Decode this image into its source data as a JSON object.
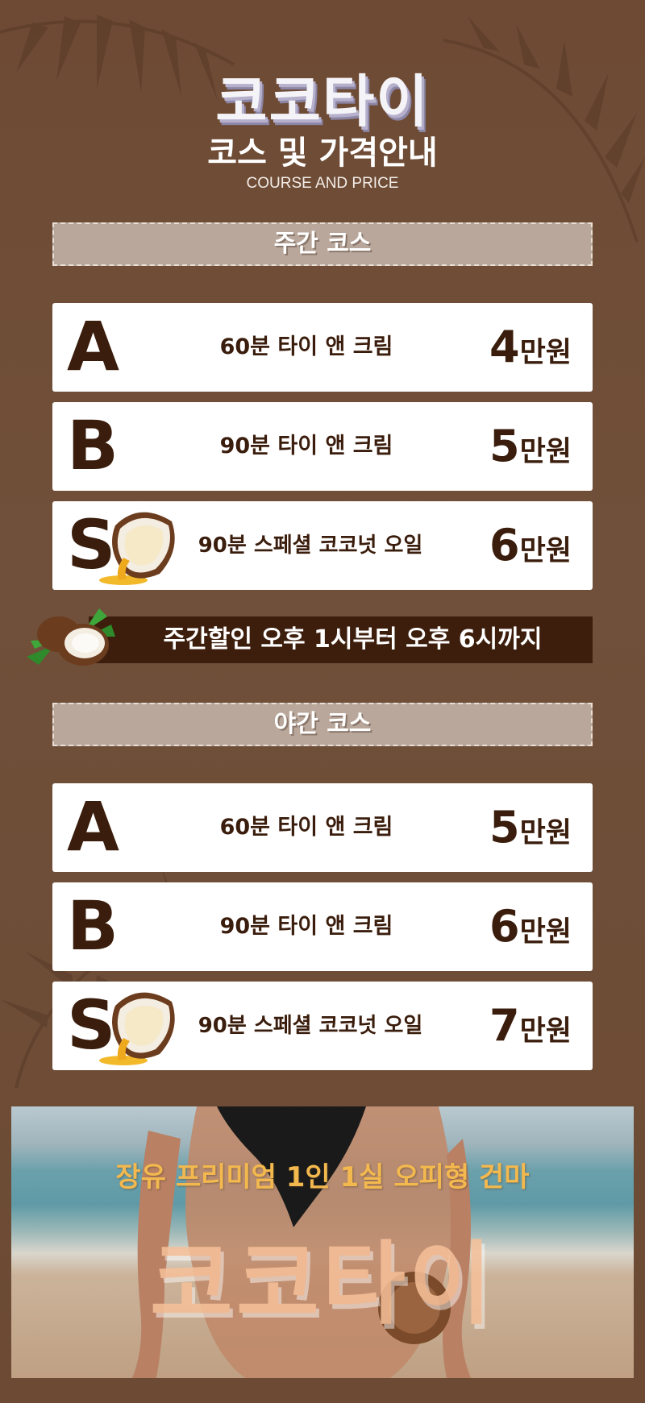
{
  "header": {
    "title": "코코타이",
    "subtitle": "코스 및 가격안내",
    "subtitle_en": "COURSE AND PRICE"
  },
  "day_course": {
    "label": "주간 코스",
    "items": [
      {
        "letter": "A",
        "name": "60분 타이 앤 크림",
        "price_num": "4",
        "price_unit": "만원"
      },
      {
        "letter": "B",
        "name": "90분 타이 앤 크림",
        "price_num": "5",
        "price_unit": "만원"
      },
      {
        "letter": "S",
        "name": "90분 스페셜 코코넛 오일",
        "price_num": "6",
        "price_unit": "만원"
      }
    ]
  },
  "discount": {
    "text": "주간할인 오후 1시부터 오후 6시까지"
  },
  "night_course": {
    "label": "야간 코스",
    "items": [
      {
        "letter": "A",
        "name": "60분 타이 앤 크림",
        "price_num": "5",
        "price_unit": "만원"
      },
      {
        "letter": "B",
        "name": "90분 타이 앤 크림",
        "price_num": "6",
        "price_unit": "만원"
      },
      {
        "letter": "S",
        "name": "90분 스페셜 코코넛 오일",
        "price_num": "7",
        "price_unit": "만원"
      }
    ]
  },
  "banner": {
    "tagline": "장유 프리미엄 1인 1실 오피형 건마",
    "brand": "코코타이"
  },
  "colors": {
    "background": "#6f4b35",
    "dark_brown": "#3a1d0c",
    "section_head": "#b8a79a",
    "card": "#ffffff",
    "tagline": "#f3b84e"
  }
}
